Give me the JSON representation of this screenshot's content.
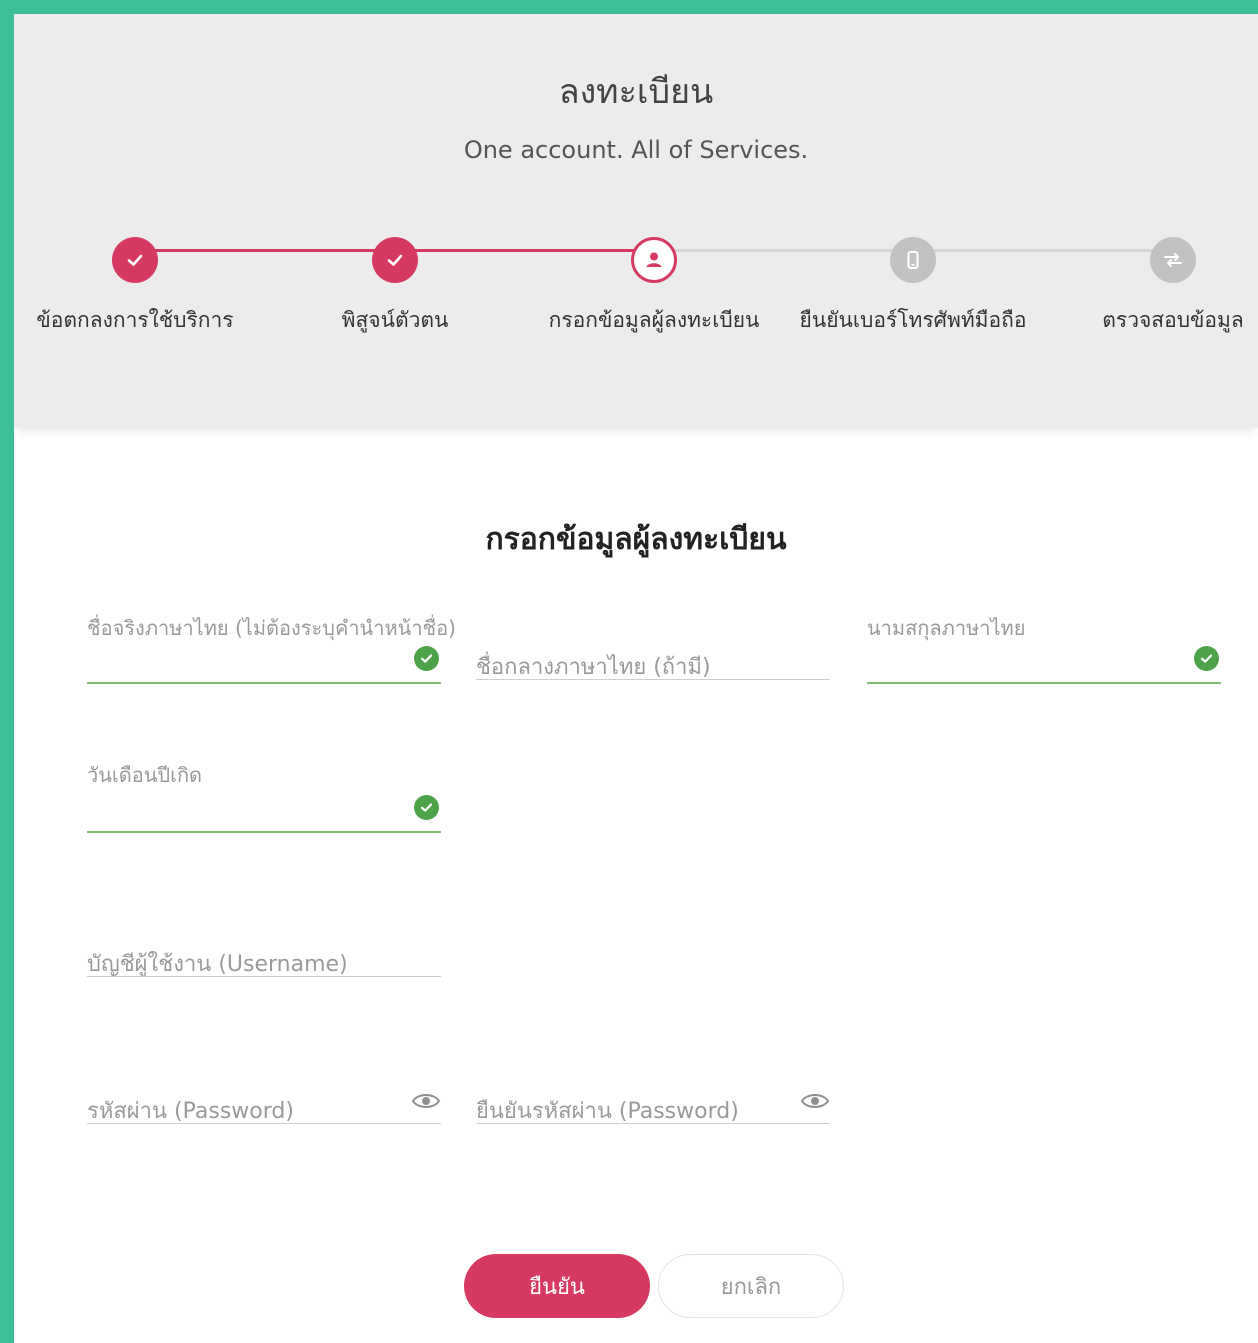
{
  "header": {
    "title": "ลงทะเบียน",
    "subtitle": "One account. All of Services."
  },
  "steps": [
    {
      "label": "ข้อตกลงการใช้บริการ",
      "status": "done",
      "icon": "check-icon"
    },
    {
      "label": "พิสูจน์ตัวตน",
      "status": "done",
      "icon": "check-icon"
    },
    {
      "label": "กรอกข้อมูลผู้ลงทะเบียน",
      "status": "current",
      "icon": "user-icon"
    },
    {
      "label": "ยืนยันเบอร์โทรศัพท์มือถือ",
      "status": "pending",
      "icon": "mobile-icon"
    },
    {
      "label": "ตรวจสอบข้อมูล",
      "status": "pending",
      "icon": "transfer-icon"
    }
  ],
  "form": {
    "title": "กรอกข้อมูลผู้ลงทะเบียน",
    "fields": {
      "first_name": {
        "label": "ชื่อจริงภาษาไทย (ไม่ต้องระบุคำนำหน้าชื่อ)",
        "value": "",
        "valid": true
      },
      "middle_name": {
        "label": "ชื่อกลางภาษาไทย (ถ้ามี)",
        "value": ""
      },
      "last_name": {
        "label": "นามสกุลภาษาไทย",
        "value": "",
        "valid": true
      },
      "birth_date": {
        "label": "วันเดือนปีเกิด",
        "value": "",
        "valid": true
      },
      "username": {
        "label": "บัญชีผู้ใช้งาน (Username)",
        "value": ""
      },
      "password": {
        "label": "รหัสผ่าน (Password)",
        "value": ""
      },
      "password_confirm": {
        "label": "ยืนยันรหัสผ่าน (Password)",
        "value": ""
      }
    }
  },
  "buttons": {
    "confirm": "ยืนยัน",
    "cancel": "ยกเลิก"
  },
  "colors": {
    "accent": "#d63a62",
    "valid": "#4ea24a",
    "page_border": "#3cbf97",
    "header_bg": "#ececec"
  }
}
